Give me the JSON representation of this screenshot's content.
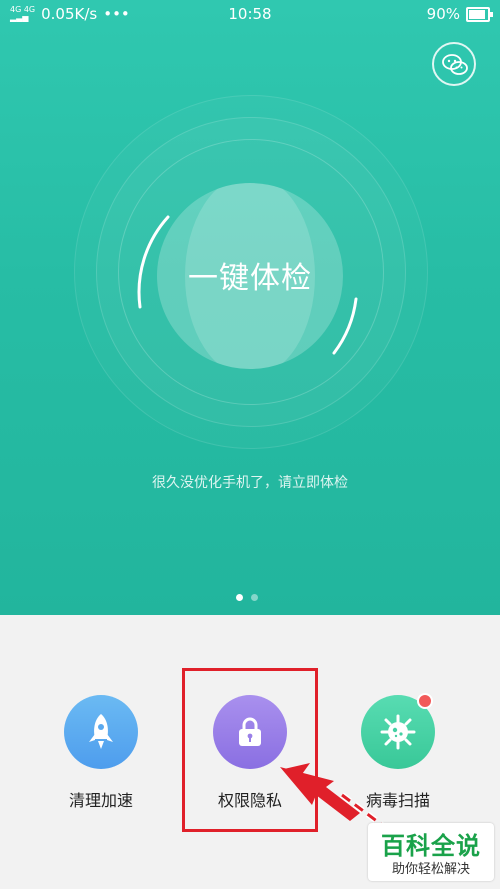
{
  "status_bar": {
    "network_type": "4G 4G",
    "speed": "0.05K/s",
    "more": "•••",
    "time": "10:58",
    "battery": "90%"
  },
  "hero": {
    "check_button_label": "一键体检",
    "hint": "很久没优化手机了，请立即体检",
    "page_indicator": {
      "pages": 2,
      "active": 1
    }
  },
  "features": [
    {
      "label": "清理加速",
      "icon": "rocket-icon"
    },
    {
      "label": "权限隐私",
      "icon": "lock-icon"
    },
    {
      "label": "病毒扫描",
      "icon": "virus-icon",
      "has_badge": true
    }
  ],
  "watermark": {
    "title": "百科全说",
    "subtitle": "助你轻松解决"
  },
  "colors": {
    "hero_bg": "#27bda5",
    "highlight": "#e0202a",
    "watermark_green": "#1aa24a"
  }
}
